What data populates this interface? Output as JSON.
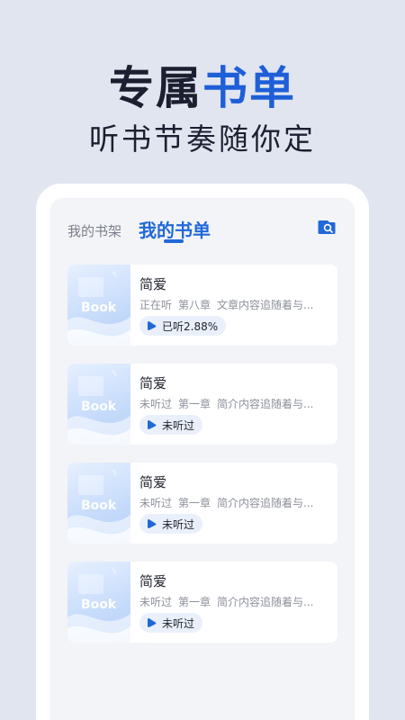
{
  "hero": {
    "title_part1": "专属",
    "title_part2": "书单",
    "subtitle": "听书节奏随你定"
  },
  "tabs": {
    "shelf": "我的书架",
    "list": "我的书单",
    "active": "list"
  },
  "colors": {
    "accent": "#2168d8",
    "background": "#e1e5f0",
    "title_dark": "#1b1f30"
  },
  "search_icon": "search-icon",
  "books": [
    {
      "cover_text": "Book",
      "title": "简爱",
      "status": "正在听",
      "chapter": "第八章",
      "summary": "文章内容追随着与...",
      "badge": "已听2.88%"
    },
    {
      "cover_text": "Book",
      "title": "简爱",
      "status": "未听过",
      "chapter": "第一章",
      "summary": "简介内容追随着与...",
      "badge": "未听过"
    },
    {
      "cover_text": "Book",
      "title": "简爱",
      "status": "未听过",
      "chapter": "第一章",
      "summary": "简介内容追随着与...",
      "badge": "未听过"
    },
    {
      "cover_text": "Book",
      "title": "简爱",
      "status": "未听过",
      "chapter": "第一章",
      "summary": "简介内容追随着与...",
      "badge": "未听过"
    }
  ]
}
